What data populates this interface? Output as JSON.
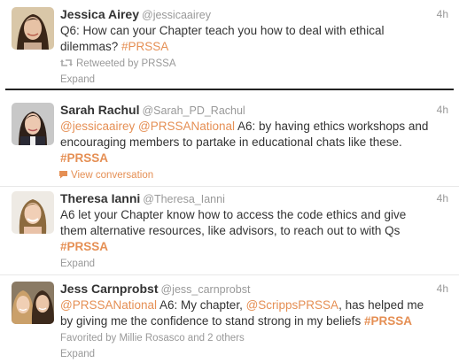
{
  "tweets": [
    {
      "name": "Jessica Airey",
      "handle": "@jessicaairey",
      "time": "4h",
      "line1": "Q6: How can your Chapter teach you how to deal with ethical",
      "line2_text": "dilemmas? ",
      "line2_hash": "#PRSSA",
      "retweeted": "Retweeted by PRSSA",
      "expand": "Expand"
    },
    {
      "name": "Sarah Rachul",
      "handle": "@Sarah_PD_Rachul",
      "time": "4h",
      "mention1": "@jessicaairey",
      "mention2": "@PRSSANational",
      "line1_rest": " A6: by having ethics workshops and",
      "line2": "encouraging members to partake in educational chats like these.",
      "hash": "#PRSSA",
      "view_conversation": "View conversation"
    },
    {
      "name": "Theresa Ianni",
      "handle": "@Theresa_Ianni",
      "time": "4h",
      "line1": "A6 let your Chapter know how to access the code ethics and give",
      "line2": "them alternative resources, like advisors, to reach out to with Qs",
      "hash": "#PRSSA",
      "expand": "Expand"
    },
    {
      "name": "Jess Carnprobst",
      "handle": "@jess_carnprobst",
      "time": "4h",
      "mention1": "@PRSSANational",
      "line1_mid": " A6: My chapter, ",
      "mention2": "@ScrippsPRSSA",
      "line1_rest": ", has helped me",
      "line2_text": "by giving me the confidence to stand strong in my beliefs ",
      "hash": "#PRSSA",
      "favorited": "Favorited by Millie Rosasco and 2 others",
      "expand": "Expand"
    }
  ],
  "colors": {
    "link": "#e58f54",
    "muted": "#999999",
    "text": "#333333"
  }
}
